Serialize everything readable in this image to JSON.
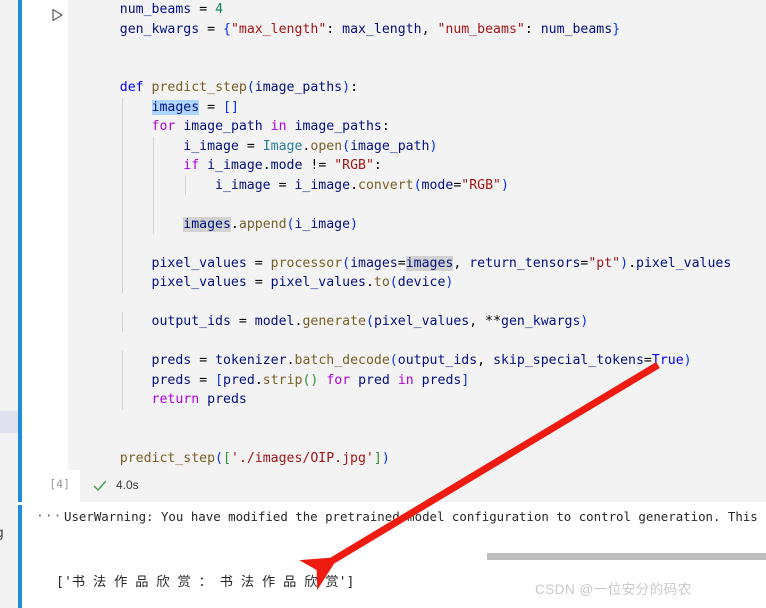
{
  "editor": {
    "cell_type": "code",
    "run_button_label": "run-cell",
    "execution_count": "[4]",
    "execution_time": "4.0s",
    "status_icon": "check-icon",
    "clipped_left_glyph": "g"
  },
  "code": {
    "lines": [
      [
        {
          "t": "    ",
          "c": "pln"
        },
        {
          "t": "num_beams",
          "c": "var"
        },
        {
          "t": " ",
          "c": "pln"
        },
        {
          "t": "=",
          "c": "op"
        },
        {
          "t": " ",
          "c": "pln"
        },
        {
          "t": "4",
          "c": "num"
        }
      ],
      [
        {
          "t": "    ",
          "c": "pln"
        },
        {
          "t": "gen_kwargs",
          "c": "var"
        },
        {
          "t": " ",
          "c": "pln"
        },
        {
          "t": "=",
          "c": "op"
        },
        {
          "t": " ",
          "c": "pln"
        },
        {
          "t": "{",
          "c": "br1"
        },
        {
          "t": "\"max_length\"",
          "c": "str"
        },
        {
          "t": ":",
          "c": "op"
        },
        {
          "t": " ",
          "c": "pln"
        },
        {
          "t": "max_length",
          "c": "var"
        },
        {
          "t": ",",
          "c": "op"
        },
        {
          "t": " ",
          "c": "pln"
        },
        {
          "t": "\"num_beams\"",
          "c": "str"
        },
        {
          "t": ":",
          "c": "op"
        },
        {
          "t": " ",
          "c": "pln"
        },
        {
          "t": "num_beams",
          "c": "var"
        },
        {
          "t": "}",
          "c": "br1"
        }
      ],
      [],
      [],
      [
        {
          "t": "    ",
          "c": "pln"
        },
        {
          "t": "def",
          "c": "kw"
        },
        {
          "t": " ",
          "c": "pln"
        },
        {
          "t": "predict_step",
          "c": "fn"
        },
        {
          "t": "(",
          "c": "br1"
        },
        {
          "t": "image_paths",
          "c": "var"
        },
        {
          "t": ")",
          "c": "br1"
        },
        {
          "t": ":",
          "c": "op"
        }
      ],
      [
        {
          "t": "        ",
          "c": "pln"
        },
        {
          "t": "images",
          "c": "var sel-hi"
        },
        {
          "t": " ",
          "c": "pln"
        },
        {
          "t": "=",
          "c": "op"
        },
        {
          "t": " ",
          "c": "pln"
        },
        {
          "t": "[]",
          "c": "br1"
        }
      ],
      [
        {
          "t": "        ",
          "c": "pln"
        },
        {
          "t": "for",
          "c": "kw2"
        },
        {
          "t": " ",
          "c": "pln"
        },
        {
          "t": "image_path",
          "c": "var"
        },
        {
          "t": " ",
          "c": "pln"
        },
        {
          "t": "in",
          "c": "kw2"
        },
        {
          "t": " ",
          "c": "pln"
        },
        {
          "t": "image_paths",
          "c": "var"
        },
        {
          "t": ":",
          "c": "op"
        }
      ],
      [
        {
          "t": "            ",
          "c": "pln"
        },
        {
          "t": "i_image",
          "c": "var"
        },
        {
          "t": " ",
          "c": "pln"
        },
        {
          "t": "=",
          "c": "op"
        },
        {
          "t": " ",
          "c": "pln"
        },
        {
          "t": "Image",
          "c": "cls"
        },
        {
          "t": ".",
          "c": "op"
        },
        {
          "t": "open",
          "c": "fn"
        },
        {
          "t": "(",
          "c": "br1"
        },
        {
          "t": "image_path",
          "c": "var"
        },
        {
          "t": ")",
          "c": "br1"
        }
      ],
      [
        {
          "t": "            ",
          "c": "pln"
        },
        {
          "t": "if",
          "c": "kw2"
        },
        {
          "t": " ",
          "c": "pln"
        },
        {
          "t": "i_image",
          "c": "var"
        },
        {
          "t": ".",
          "c": "op"
        },
        {
          "t": "mode",
          "c": "var"
        },
        {
          "t": " ",
          "c": "pln"
        },
        {
          "t": "!=",
          "c": "op"
        },
        {
          "t": " ",
          "c": "pln"
        },
        {
          "t": "\"RGB\"",
          "c": "str"
        },
        {
          "t": ":",
          "c": "op"
        }
      ],
      [
        {
          "t": "                ",
          "c": "pln"
        },
        {
          "t": "i_image",
          "c": "var"
        },
        {
          "t": " ",
          "c": "pln"
        },
        {
          "t": "=",
          "c": "op"
        },
        {
          "t": " ",
          "c": "pln"
        },
        {
          "t": "i_image",
          "c": "var"
        },
        {
          "t": ".",
          "c": "op"
        },
        {
          "t": "convert",
          "c": "fn"
        },
        {
          "t": "(",
          "c": "br1"
        },
        {
          "t": "mode",
          "c": "var"
        },
        {
          "t": "=",
          "c": "op"
        },
        {
          "t": "\"RGB\"",
          "c": "str"
        },
        {
          "t": ")",
          "c": "br1"
        }
      ],
      [],
      [
        {
          "t": "            ",
          "c": "pln"
        },
        {
          "t": "images",
          "c": "var occ-hi"
        },
        {
          "t": ".",
          "c": "op"
        },
        {
          "t": "append",
          "c": "fn"
        },
        {
          "t": "(",
          "c": "br1"
        },
        {
          "t": "i_image",
          "c": "var"
        },
        {
          "t": ")",
          "c": "br1"
        }
      ],
      [],
      [
        {
          "t": "        ",
          "c": "pln"
        },
        {
          "t": "pixel_values",
          "c": "var"
        },
        {
          "t": " ",
          "c": "pln"
        },
        {
          "t": "=",
          "c": "op"
        },
        {
          "t": " ",
          "c": "pln"
        },
        {
          "t": "processor",
          "c": "fn"
        },
        {
          "t": "(",
          "c": "br1"
        },
        {
          "t": "images",
          "c": "var"
        },
        {
          "t": "=",
          "c": "op"
        },
        {
          "t": "images",
          "c": "var occ-hi"
        },
        {
          "t": ",",
          "c": "op"
        },
        {
          "t": " ",
          "c": "pln"
        },
        {
          "t": "return_tensors",
          "c": "var"
        },
        {
          "t": "=",
          "c": "op"
        },
        {
          "t": "\"pt\"",
          "c": "str"
        },
        {
          "t": ")",
          "c": "br1"
        },
        {
          "t": ".",
          "c": "op"
        },
        {
          "t": "pixel_values",
          "c": "var"
        }
      ],
      [
        {
          "t": "        ",
          "c": "pln"
        },
        {
          "t": "pixel_values",
          "c": "var"
        },
        {
          "t": " ",
          "c": "pln"
        },
        {
          "t": "=",
          "c": "op"
        },
        {
          "t": " ",
          "c": "pln"
        },
        {
          "t": "pixel_values",
          "c": "var"
        },
        {
          "t": ".",
          "c": "op"
        },
        {
          "t": "to",
          "c": "fn"
        },
        {
          "t": "(",
          "c": "br1"
        },
        {
          "t": "device",
          "c": "var"
        },
        {
          "t": ")",
          "c": "br1"
        }
      ],
      [],
      [
        {
          "t": "        ",
          "c": "pln"
        },
        {
          "t": "output_ids",
          "c": "var"
        },
        {
          "t": " ",
          "c": "pln"
        },
        {
          "t": "=",
          "c": "op"
        },
        {
          "t": " ",
          "c": "pln"
        },
        {
          "t": "model",
          "c": "var"
        },
        {
          "t": ".",
          "c": "op"
        },
        {
          "t": "generate",
          "c": "fn"
        },
        {
          "t": "(",
          "c": "br1"
        },
        {
          "t": "pixel_values",
          "c": "var"
        },
        {
          "t": ",",
          "c": "op"
        },
        {
          "t": " ",
          "c": "pln"
        },
        {
          "t": "**",
          "c": "op"
        },
        {
          "t": "gen_kwargs",
          "c": "var"
        },
        {
          "t": ")",
          "c": "br1"
        }
      ],
      [],
      [
        {
          "t": "        ",
          "c": "pln"
        },
        {
          "t": "preds",
          "c": "var"
        },
        {
          "t": " ",
          "c": "pln"
        },
        {
          "t": "=",
          "c": "op"
        },
        {
          "t": " ",
          "c": "pln"
        },
        {
          "t": "tokenizer",
          "c": "var"
        },
        {
          "t": ".",
          "c": "op"
        },
        {
          "t": "batch_decode",
          "c": "fn"
        },
        {
          "t": "(",
          "c": "br1"
        },
        {
          "t": "output_ids",
          "c": "var"
        },
        {
          "t": ",",
          "c": "op"
        },
        {
          "t": " ",
          "c": "pln"
        },
        {
          "t": "skip_special_tokens",
          "c": "var"
        },
        {
          "t": "=",
          "c": "op"
        },
        {
          "t": "True",
          "c": "cst"
        },
        {
          "t": ")",
          "c": "br1"
        }
      ],
      [
        {
          "t": "        ",
          "c": "pln"
        },
        {
          "t": "preds",
          "c": "var"
        },
        {
          "t": " ",
          "c": "pln"
        },
        {
          "t": "=",
          "c": "op"
        },
        {
          "t": " ",
          "c": "pln"
        },
        {
          "t": "[",
          "c": "br1"
        },
        {
          "t": "pred",
          "c": "var"
        },
        {
          "t": ".",
          "c": "op"
        },
        {
          "t": "strip",
          "c": "fn"
        },
        {
          "t": "()",
          "c": "br2"
        },
        {
          "t": " ",
          "c": "pln"
        },
        {
          "t": "for",
          "c": "kw2"
        },
        {
          "t": " ",
          "c": "pln"
        },
        {
          "t": "pred",
          "c": "var"
        },
        {
          "t": " ",
          "c": "pln"
        },
        {
          "t": "in",
          "c": "kw2"
        },
        {
          "t": " ",
          "c": "pln"
        },
        {
          "t": "preds",
          "c": "var"
        },
        {
          "t": "]",
          "c": "br1"
        }
      ],
      [
        {
          "t": "        ",
          "c": "pln"
        },
        {
          "t": "return",
          "c": "kw2"
        },
        {
          "t": " ",
          "c": "pln"
        },
        {
          "t": "preds",
          "c": "var"
        }
      ],
      [],
      [],
      [
        {
          "t": "    ",
          "c": "pln"
        },
        {
          "t": "predict_step",
          "c": "fn"
        },
        {
          "t": "(",
          "c": "br1"
        },
        {
          "t": "[",
          "c": "br2"
        },
        {
          "t": "'./images/OIP.jpg'",
          "c": "str"
        },
        {
          "t": "]",
          "c": "br2"
        },
        {
          "t": ")",
          "c": "br1"
        }
      ]
    ]
  },
  "output": {
    "dots": "···",
    "warning_text": "UserWarning: You have modified the pretrained model configuration to control generation. This",
    "result_text": "['书 法 作 品 欣 赏 ： 书 法 作 品 欣 赏']",
    "scrollbar": "horizontal-scrollbar"
  },
  "watermark": {
    "text": "CSDN @一位安分的码农"
  },
  "annotation": {
    "arrow": "red-annotation-arrow"
  },
  "colors": {
    "accent_blue": "#1f8ce0",
    "cell_bg": "#f3f3f3",
    "annotation_red": "#ee1b11",
    "watermark_gray": "#c9c9c9"
  }
}
